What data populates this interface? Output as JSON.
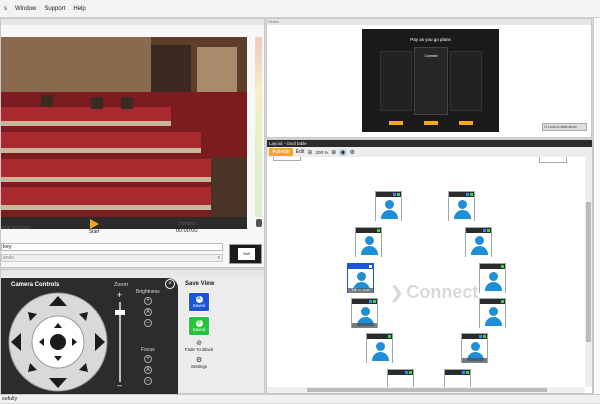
{
  "menu": {
    "items": [
      "s",
      "Window",
      "Support",
      "Help"
    ]
  },
  "left": {
    "source_label": "ocal webcast",
    "start_label": "Start",
    "duration_label": "Duration",
    "duration_value": "00:00:00",
    "key_input": "key",
    "combo_text": "ands",
    "thumb_label": "Sell"
  },
  "camera": {
    "title": "Camera Controls",
    "zoom_label": "Zoom",
    "brightness_label": "Brightness",
    "focus_label": "Focus",
    "save_view_title": "Save View",
    "btn_a": {
      "letter": "A",
      "state": "Saved"
    },
    "btn_b": {
      "letter": "B",
      "state": "Saved"
    },
    "fade_label": "Fade To Black",
    "settings_label": "Settings"
  },
  "preview": {
    "title": "Slides",
    "slide_heading": "Pay as you go plans",
    "slide_col1": "Connect",
    "checkbox_label": "Lock to slide show"
  },
  "layout": {
    "title": "Layout - Oval table",
    "activate_label": "Activate",
    "edit_label": "Edit",
    "zoom_value": "200 %",
    "watermark": "Connect",
    "seat_caption": "Talk to mute"
  },
  "status": {
    "text": "ssfully"
  },
  "colors": {
    "orange": "#f5a623",
    "blue": "#1e8fd6",
    "save_a": "#1b55d6",
    "save_b": "#27c33a",
    "dark": "#2b2b2b"
  }
}
